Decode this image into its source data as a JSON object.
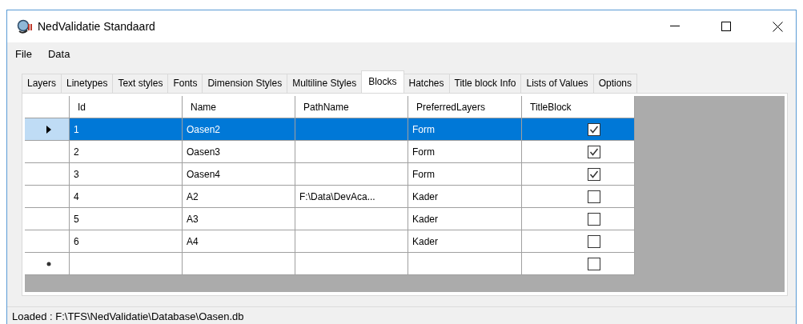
{
  "window": {
    "title": "NedValidatie Standaard"
  },
  "menu": [
    "File",
    "Data"
  ],
  "tabs": [
    {
      "label": "Layers",
      "selected": false
    },
    {
      "label": "Linetypes",
      "selected": false
    },
    {
      "label": "Text styles",
      "selected": false
    },
    {
      "label": "Fonts",
      "selected": false
    },
    {
      "label": "Dimension Styles",
      "selected": false
    },
    {
      "label": "Multiline Styles",
      "selected": false
    },
    {
      "label": "Blocks",
      "selected": true
    },
    {
      "label": "Hatches",
      "selected": false
    },
    {
      "label": "Title block Info",
      "selected": false
    },
    {
      "label": "Lists of Values",
      "selected": false
    },
    {
      "label": "Options",
      "selected": false
    }
  ],
  "table": {
    "columns": [
      "Id",
      "Name",
      "PathName",
      "PreferredLayers",
      "TitleBlock"
    ],
    "rows": [
      {
        "kind": "data",
        "selected": true,
        "cells": [
          "1",
          "Oasen2",
          "",
          "Form"
        ],
        "checked": true
      },
      {
        "kind": "data",
        "selected": false,
        "cells": [
          "2",
          "Oasen3",
          "",
          "Form"
        ],
        "checked": true
      },
      {
        "kind": "data",
        "selected": false,
        "cells": [
          "3",
          "Oasen4",
          "",
          "Form"
        ],
        "checked": true
      },
      {
        "kind": "data",
        "selected": false,
        "cells": [
          "4",
          "A2",
          "F:\\Data\\DevAca...",
          "Kader"
        ],
        "checked": false
      },
      {
        "kind": "data",
        "selected": false,
        "cells": [
          "5",
          "A3",
          "",
          "Kader"
        ],
        "checked": false
      },
      {
        "kind": "data",
        "selected": false,
        "cells": [
          "6",
          "A4",
          "",
          "Kader"
        ],
        "checked": false
      },
      {
        "kind": "new",
        "selected": false,
        "cells": [
          "",
          "",
          "",
          ""
        ],
        "checked": false
      }
    ]
  },
  "status_bar": "Loaded : F:\\TFS\\NedValidatie\\Database\\Oasen.db"
}
